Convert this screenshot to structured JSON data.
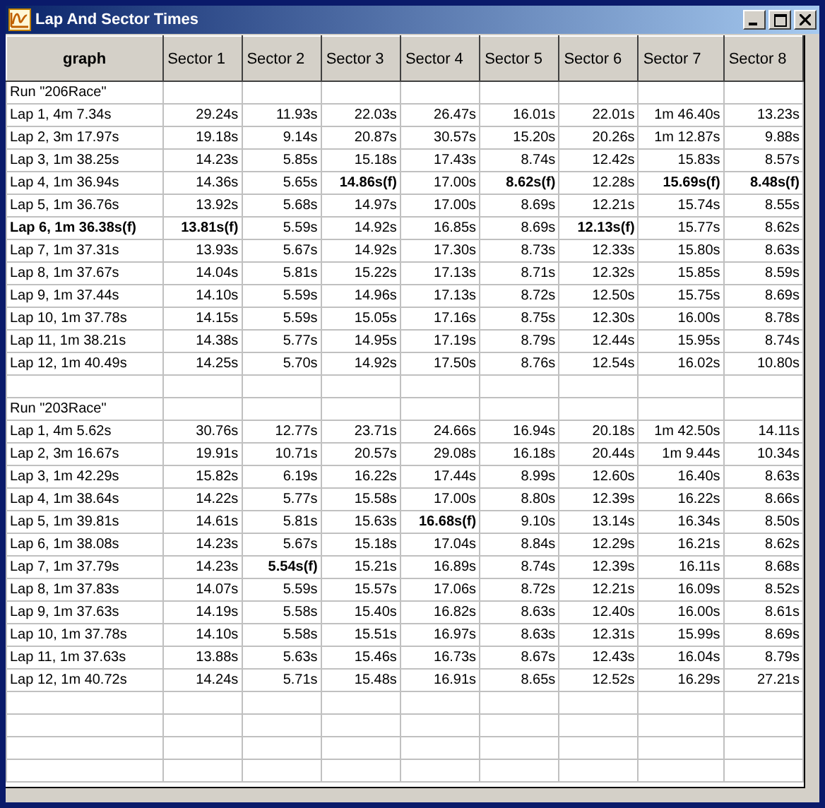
{
  "window": {
    "title": "Lap And Sector Times"
  },
  "table": {
    "columns": [
      "graph",
      "Sector 1",
      "Sector 2",
      "Sector 3",
      "Sector 4",
      "Sector 5",
      "Sector 6",
      "Sector 7",
      "Sector 8"
    ],
    "rows": [
      {
        "kind": "run",
        "label": "Run \"206Race\""
      },
      {
        "kind": "lap",
        "label": "Lap 1, 4m 7.34s",
        "best": false,
        "cells": [
          {
            "value": "29.24s",
            "best": false
          },
          {
            "value": "11.93s",
            "best": false
          },
          {
            "value": "22.03s",
            "best": false
          },
          {
            "value": "26.47s",
            "best": false
          },
          {
            "value": "16.01s",
            "best": false
          },
          {
            "value": "22.01s",
            "best": false
          },
          {
            "value": "1m 46.40s",
            "best": false
          },
          {
            "value": "13.23s",
            "best": false
          }
        ]
      },
      {
        "kind": "lap",
        "label": "Lap 2, 3m 17.97s",
        "best": false,
        "cells": [
          {
            "value": "19.18s",
            "best": false
          },
          {
            "value": "9.14s",
            "best": false
          },
          {
            "value": "20.87s",
            "best": false
          },
          {
            "value": "30.57s",
            "best": false
          },
          {
            "value": "15.20s",
            "best": false
          },
          {
            "value": "20.26s",
            "best": false
          },
          {
            "value": "1m 12.87s",
            "best": false
          },
          {
            "value": "9.88s",
            "best": false
          }
        ]
      },
      {
        "kind": "lap",
        "label": "Lap 3, 1m 38.25s",
        "best": false,
        "cells": [
          {
            "value": "14.23s",
            "best": false
          },
          {
            "value": "5.85s",
            "best": false
          },
          {
            "value": "15.18s",
            "best": false
          },
          {
            "value": "17.43s",
            "best": false
          },
          {
            "value": "8.74s",
            "best": false
          },
          {
            "value": "12.42s",
            "best": false
          },
          {
            "value": "15.83s",
            "best": false
          },
          {
            "value": "8.57s",
            "best": false
          }
        ]
      },
      {
        "kind": "lap",
        "label": "Lap 4, 1m 36.94s",
        "best": false,
        "cells": [
          {
            "value": "14.36s",
            "best": false
          },
          {
            "value": "5.65s",
            "best": false
          },
          {
            "value": "14.86s(f)",
            "best": true
          },
          {
            "value": "17.00s",
            "best": false
          },
          {
            "value": "8.62s(f)",
            "best": true
          },
          {
            "value": "12.28s",
            "best": false
          },
          {
            "value": "15.69s(f)",
            "best": true
          },
          {
            "value": "8.48s(f)",
            "best": true
          }
        ]
      },
      {
        "kind": "lap",
        "label": "Lap 5, 1m 36.76s",
        "best": false,
        "cells": [
          {
            "value": "13.92s",
            "best": false
          },
          {
            "value": "5.68s",
            "best": false
          },
          {
            "value": "14.97s",
            "best": false
          },
          {
            "value": "17.00s",
            "best": false
          },
          {
            "value": "8.69s",
            "best": false
          },
          {
            "value": "12.21s",
            "best": false
          },
          {
            "value": "15.74s",
            "best": false
          },
          {
            "value": "8.55s",
            "best": false
          }
        ]
      },
      {
        "kind": "lap",
        "label": "Lap 6, 1m 36.38s(f)",
        "best": true,
        "cells": [
          {
            "value": "13.81s(f)",
            "best": true
          },
          {
            "value": "5.59s",
            "best": false
          },
          {
            "value": "14.92s",
            "best": false
          },
          {
            "value": "16.85s",
            "best": false
          },
          {
            "value": "8.69s",
            "best": false
          },
          {
            "value": "12.13s(f)",
            "best": true
          },
          {
            "value": "15.77s",
            "best": false
          },
          {
            "value": "8.62s",
            "best": false
          }
        ]
      },
      {
        "kind": "lap",
        "label": "Lap 7, 1m 37.31s",
        "best": false,
        "cells": [
          {
            "value": "13.93s",
            "best": false
          },
          {
            "value": "5.67s",
            "best": false
          },
          {
            "value": "14.92s",
            "best": false
          },
          {
            "value": "17.30s",
            "best": false
          },
          {
            "value": "8.73s",
            "best": false
          },
          {
            "value": "12.33s",
            "best": false
          },
          {
            "value": "15.80s",
            "best": false
          },
          {
            "value": "8.63s",
            "best": false
          }
        ]
      },
      {
        "kind": "lap",
        "label": "Lap 8, 1m 37.67s",
        "best": false,
        "cells": [
          {
            "value": "14.04s",
            "best": false
          },
          {
            "value": "5.81s",
            "best": false
          },
          {
            "value": "15.22s",
            "best": false
          },
          {
            "value": "17.13s",
            "best": false
          },
          {
            "value": "8.71s",
            "best": false
          },
          {
            "value": "12.32s",
            "best": false
          },
          {
            "value": "15.85s",
            "best": false
          },
          {
            "value": "8.59s",
            "best": false
          }
        ]
      },
      {
        "kind": "lap",
        "label": "Lap 9, 1m 37.44s",
        "best": false,
        "cells": [
          {
            "value": "14.10s",
            "best": false
          },
          {
            "value": "5.59s",
            "best": false
          },
          {
            "value": "14.96s",
            "best": false
          },
          {
            "value": "17.13s",
            "best": false
          },
          {
            "value": "8.72s",
            "best": false
          },
          {
            "value": "12.50s",
            "best": false
          },
          {
            "value": "15.75s",
            "best": false
          },
          {
            "value": "8.69s",
            "best": false
          }
        ]
      },
      {
        "kind": "lap",
        "label": "Lap 10, 1m 37.78s",
        "best": false,
        "cells": [
          {
            "value": "14.15s",
            "best": false
          },
          {
            "value": "5.59s",
            "best": false
          },
          {
            "value": "15.05s",
            "best": false
          },
          {
            "value": "17.16s",
            "best": false
          },
          {
            "value": "8.75s",
            "best": false
          },
          {
            "value": "12.30s",
            "best": false
          },
          {
            "value": "16.00s",
            "best": false
          },
          {
            "value": "8.78s",
            "best": false
          }
        ]
      },
      {
        "kind": "lap",
        "label": "Lap 11, 1m 38.21s",
        "best": false,
        "cells": [
          {
            "value": "14.38s",
            "best": false
          },
          {
            "value": "5.77s",
            "best": false
          },
          {
            "value": "14.95s",
            "best": false
          },
          {
            "value": "17.19s",
            "best": false
          },
          {
            "value": "8.79s",
            "best": false
          },
          {
            "value": "12.44s",
            "best": false
          },
          {
            "value": "15.95s",
            "best": false
          },
          {
            "value": "8.74s",
            "best": false
          }
        ]
      },
      {
        "kind": "lap",
        "label": "Lap 12, 1m 40.49s",
        "best": false,
        "cells": [
          {
            "value": "14.25s",
            "best": false
          },
          {
            "value": "5.70s",
            "best": false
          },
          {
            "value": "14.92s",
            "best": false
          },
          {
            "value": "17.50s",
            "best": false
          },
          {
            "value": "8.76s",
            "best": false
          },
          {
            "value": "12.54s",
            "best": false
          },
          {
            "value": "16.02s",
            "best": false
          },
          {
            "value": "10.80s",
            "best": false
          }
        ]
      },
      {
        "kind": "blank"
      },
      {
        "kind": "run",
        "label": "Run \"203Race\""
      },
      {
        "kind": "lap",
        "label": "Lap 1, 4m 5.62s",
        "best": false,
        "cells": [
          {
            "value": "30.76s",
            "best": false
          },
          {
            "value": "12.77s",
            "best": false
          },
          {
            "value": "23.71s",
            "best": false
          },
          {
            "value": "24.66s",
            "best": false
          },
          {
            "value": "16.94s",
            "best": false
          },
          {
            "value": "20.18s",
            "best": false
          },
          {
            "value": "1m 42.50s",
            "best": false
          },
          {
            "value": "14.11s",
            "best": false
          }
        ]
      },
      {
        "kind": "lap",
        "label": "Lap 2, 3m 16.67s",
        "best": false,
        "cells": [
          {
            "value": "19.91s",
            "best": false
          },
          {
            "value": "10.71s",
            "best": false
          },
          {
            "value": "20.57s",
            "best": false
          },
          {
            "value": "29.08s",
            "best": false
          },
          {
            "value": "16.18s",
            "best": false
          },
          {
            "value": "20.44s",
            "best": false
          },
          {
            "value": "1m 9.44s",
            "best": false
          },
          {
            "value": "10.34s",
            "best": false
          }
        ]
      },
      {
        "kind": "lap",
        "label": "Lap 3, 1m 42.29s",
        "best": false,
        "cells": [
          {
            "value": "15.82s",
            "best": false
          },
          {
            "value": "6.19s",
            "best": false
          },
          {
            "value": "16.22s",
            "best": false
          },
          {
            "value": "17.44s",
            "best": false
          },
          {
            "value": "8.99s",
            "best": false
          },
          {
            "value": "12.60s",
            "best": false
          },
          {
            "value": "16.40s",
            "best": false
          },
          {
            "value": "8.63s",
            "best": false
          }
        ]
      },
      {
        "kind": "lap",
        "label": "Lap 4, 1m 38.64s",
        "best": false,
        "cells": [
          {
            "value": "14.22s",
            "best": false
          },
          {
            "value": "5.77s",
            "best": false
          },
          {
            "value": "15.58s",
            "best": false
          },
          {
            "value": "17.00s",
            "best": false
          },
          {
            "value": "8.80s",
            "best": false
          },
          {
            "value": "12.39s",
            "best": false
          },
          {
            "value": "16.22s",
            "best": false
          },
          {
            "value": "8.66s",
            "best": false
          }
        ]
      },
      {
        "kind": "lap",
        "label": "Lap 5, 1m 39.81s",
        "best": false,
        "cells": [
          {
            "value": "14.61s",
            "best": false
          },
          {
            "value": "5.81s",
            "best": false
          },
          {
            "value": "15.63s",
            "best": false
          },
          {
            "value": "16.68s(f)",
            "best": true
          },
          {
            "value": "9.10s",
            "best": false
          },
          {
            "value": "13.14s",
            "best": false
          },
          {
            "value": "16.34s",
            "best": false
          },
          {
            "value": "8.50s",
            "best": false
          }
        ]
      },
      {
        "kind": "lap",
        "label": "Lap 6, 1m 38.08s",
        "best": false,
        "cells": [
          {
            "value": "14.23s",
            "best": false
          },
          {
            "value": "5.67s",
            "best": false
          },
          {
            "value": "15.18s",
            "best": false
          },
          {
            "value": "17.04s",
            "best": false
          },
          {
            "value": "8.84s",
            "best": false
          },
          {
            "value": "12.29s",
            "best": false
          },
          {
            "value": "16.21s",
            "best": false
          },
          {
            "value": "8.62s",
            "best": false
          }
        ]
      },
      {
        "kind": "lap",
        "label": "Lap 7, 1m 37.79s",
        "best": false,
        "cells": [
          {
            "value": "14.23s",
            "best": false
          },
          {
            "value": "5.54s(f)",
            "best": true
          },
          {
            "value": "15.21s",
            "best": false
          },
          {
            "value": "16.89s",
            "best": false
          },
          {
            "value": "8.74s",
            "best": false
          },
          {
            "value": "12.39s",
            "best": false
          },
          {
            "value": "16.11s",
            "best": false
          },
          {
            "value": "8.68s",
            "best": false
          }
        ]
      },
      {
        "kind": "lap",
        "label": "Lap 8, 1m 37.83s",
        "best": false,
        "cells": [
          {
            "value": "14.07s",
            "best": false
          },
          {
            "value": "5.59s",
            "best": false
          },
          {
            "value": "15.57s",
            "best": false
          },
          {
            "value": "17.06s",
            "best": false
          },
          {
            "value": "8.72s",
            "best": false
          },
          {
            "value": "12.21s",
            "best": false
          },
          {
            "value": "16.09s",
            "best": false
          },
          {
            "value": "8.52s",
            "best": false
          }
        ]
      },
      {
        "kind": "lap",
        "label": "Lap 9, 1m 37.63s",
        "best": false,
        "cells": [
          {
            "value": "14.19s",
            "best": false
          },
          {
            "value": "5.58s",
            "best": false
          },
          {
            "value": "15.40s",
            "best": false
          },
          {
            "value": "16.82s",
            "best": false
          },
          {
            "value": "8.63s",
            "best": false
          },
          {
            "value": "12.40s",
            "best": false
          },
          {
            "value": "16.00s",
            "best": false
          },
          {
            "value": "8.61s",
            "best": false
          }
        ]
      },
      {
        "kind": "lap",
        "label": "Lap 10, 1m 37.78s",
        "best": false,
        "cells": [
          {
            "value": "14.10s",
            "best": false
          },
          {
            "value": "5.58s",
            "best": false
          },
          {
            "value": "15.51s",
            "best": false
          },
          {
            "value": "16.97s",
            "best": false
          },
          {
            "value": "8.63s",
            "best": false
          },
          {
            "value": "12.31s",
            "best": false
          },
          {
            "value": "15.99s",
            "best": false
          },
          {
            "value": "8.69s",
            "best": false
          }
        ]
      },
      {
        "kind": "lap",
        "label": "Lap 11, 1m 37.63s",
        "best": false,
        "cells": [
          {
            "value": "13.88s",
            "best": false
          },
          {
            "value": "5.63s",
            "best": false
          },
          {
            "value": "15.46s",
            "best": false
          },
          {
            "value": "16.73s",
            "best": false
          },
          {
            "value": "8.67s",
            "best": false
          },
          {
            "value": "12.43s",
            "best": false
          },
          {
            "value": "16.04s",
            "best": false
          },
          {
            "value": "8.79s",
            "best": false
          }
        ]
      },
      {
        "kind": "lap",
        "label": "Lap 12, 1m 40.72s",
        "best": false,
        "cells": [
          {
            "value": "14.24s",
            "best": false
          },
          {
            "value": "5.71s",
            "best": false
          },
          {
            "value": "15.48s",
            "best": false
          },
          {
            "value": "16.91s",
            "best": false
          },
          {
            "value": "8.65s",
            "best": false
          },
          {
            "value": "12.52s",
            "best": false
          },
          {
            "value": "16.29s",
            "best": false
          },
          {
            "value": "27.21s",
            "best": false
          }
        ]
      },
      {
        "kind": "blank"
      },
      {
        "kind": "blank"
      },
      {
        "kind": "blank"
      },
      {
        "kind": "blank"
      }
    ]
  }
}
